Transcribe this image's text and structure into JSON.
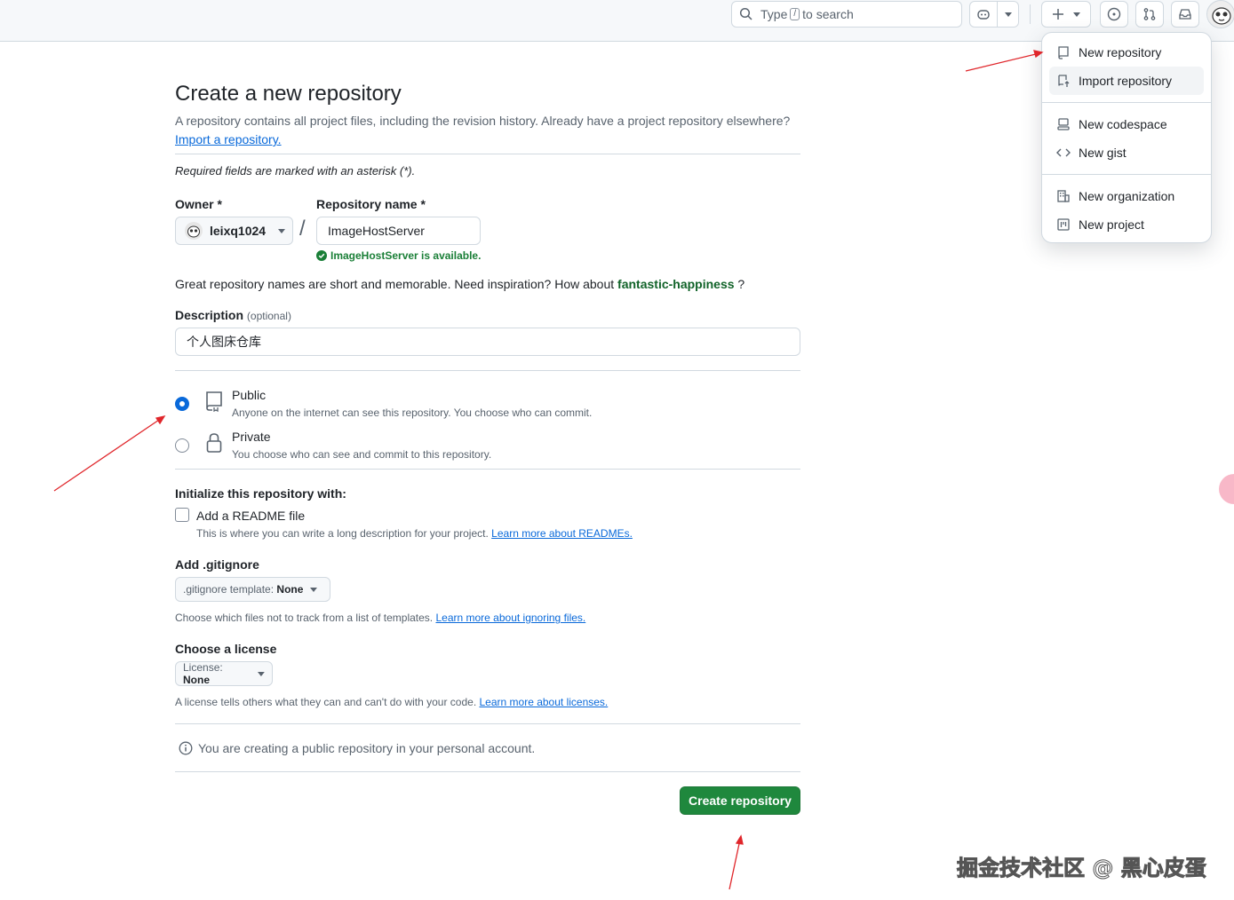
{
  "header": {
    "search_prefix": "Type",
    "search_key": "/",
    "search_suffix": "to search"
  },
  "menu": {
    "items": [
      {
        "label": "New repository",
        "icon": "repo-icon"
      },
      {
        "label": "Import repository",
        "icon": "repo-push-icon"
      },
      {
        "label": "New codespace",
        "icon": "codespace-icon"
      },
      {
        "label": "New gist",
        "icon": "code-icon"
      },
      {
        "label": "New organization",
        "icon": "organization-icon"
      },
      {
        "label": "New project",
        "icon": "project-icon"
      }
    ]
  },
  "page": {
    "title": "Create a new repository",
    "subtitle": "A repository contains all project files, including the revision history. Already have a project repository elsewhere?",
    "import_link": "Import a repository.",
    "required_note": "Required fields are marked with an asterisk (*).",
    "owner_label": "Owner *",
    "owner_value": "leixq1024",
    "slash": "/",
    "repo_name_label": "Repository name *",
    "repo_name_value": "ImageHostServer",
    "available_msg": "ImageHostServer is available.",
    "inspiration_text": "Great repository names are short and memorable. Need inspiration? How about",
    "inspiration_name": "fantastic-happiness",
    "inspiration_end": "?",
    "description_label": "Description",
    "description_optional": "(optional)",
    "description_value": "个人图床仓库",
    "visibility": {
      "public_title": "Public",
      "public_desc": "Anyone on the internet can see this repository. You choose who can commit.",
      "private_title": "Private",
      "private_desc": "You choose who can see and commit to this repository.",
      "selected": "Public"
    },
    "init_label": "Initialize this repository with:",
    "readme_label": "Add a README file",
    "readme_desc": "This is where you can write a long description for your project.",
    "readme_link": "Learn more about READMEs.",
    "gitignore_label": "Add .gitignore",
    "gitignore_btn_prefix": ".gitignore template:",
    "gitignore_btn_value": "None",
    "gitignore_desc": "Choose which files not to track from a list of templates.",
    "gitignore_link": "Learn more about ignoring files.",
    "license_label": "Choose a license",
    "license_btn_prefix": "License:",
    "license_btn_value": "None",
    "license_desc": "A license tells others what they can and can't do with your code.",
    "license_link": "Learn more about licenses.",
    "info_text": "You are creating a public repository in your personal account.",
    "create_button": "Create repository"
  },
  "watermark": "掘金技术社区 @ 黑心皮蛋",
  "colors": {
    "primary_button": "#1f883d",
    "link": "#0969da",
    "success": "#1a7f37",
    "annotation_arrow": "#e0262b"
  }
}
